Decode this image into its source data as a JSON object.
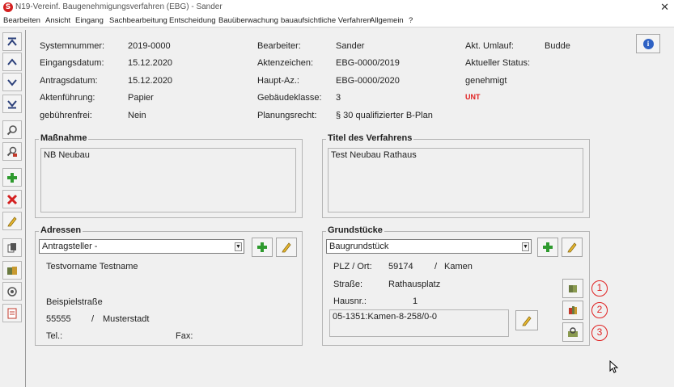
{
  "window": {
    "title": "N19-Vereinf. Baugenehmigungsverfahren (EBG) - Sander",
    "close_glyph": "✕",
    "app_icon_letter": "S"
  },
  "menu": [
    "Bearbeiten",
    "Ansicht",
    "Eingang",
    "Sachbearbeitung",
    "Entscheidung",
    "Bauüberwachung",
    "bauaufsichtliche Verfahren",
    "Allgemein",
    "?"
  ],
  "toolbar": {
    "first": "first-record-icon",
    "prev": "previous-record-icon",
    "next": "next-record-icon",
    "last": "last-record-icon",
    "search": "search-icon",
    "search_person": "search-person-icon",
    "add": "add-icon",
    "delete": "delete-icon",
    "edit": "pencil-icon",
    "copy": "copy-icon",
    "people": "people-icon",
    "eye": "eye-icon",
    "document": "document-icon"
  },
  "fields": {
    "systemnummer_label": "Systemnummer:",
    "systemnummer_value": "2019-0000",
    "eingangsdatum_label": "Eingangsdatum:",
    "eingangsdatum_value": "15.12.2020",
    "antragsdatum_label": "Antragsdatum:",
    "antragsdatum_value": "15.12.2020",
    "aktenfuehrung_label": "Aktenführung:",
    "aktenfuehrung_value": "Papier",
    "gebuehrenfrei_label": "gebührenfrei:",
    "gebuehrenfrei_value": "Nein",
    "bearbeiter_label": "Bearbeiter:",
    "bearbeiter_value": "Sander",
    "aktenzeichen_label": "Aktenzeichen:",
    "aktenzeichen_value": "EBG-0000/2019",
    "haupt_az_label": "Haupt-Az.:",
    "haupt_az_value": "EBG-0000/2020",
    "gebaeudeklasse_label": "Gebäudeklasse:",
    "gebaeudeklasse_value": "3",
    "planungsrecht_label": "Planungsrecht:",
    "planungsrecht_value": "§ 30 qualifizierter B-Plan",
    "umlauf_label": "Akt. Umlauf:",
    "umlauf_value": "Budde",
    "status_label": "Aktueller Status:",
    "status_value": "genehmigt",
    "unt_label": "UNT"
  },
  "colors": {
    "accent_red": "#e02020",
    "info_blue": "#2f62c4"
  },
  "massnahme": {
    "title": "Maßnahme",
    "text": "NB Neubau"
  },
  "titel": {
    "title": "Titel des Verfahrens",
    "text": "Test Neubau Rathaus"
  },
  "adressen": {
    "title": "Adressen",
    "combo_value": "Antragsteller  -",
    "name": "Testvorname Testname",
    "street": "Beispielstraße",
    "zip": "55555",
    "slash": "/",
    "city": "Musterstadt",
    "tel_label": "Tel.:",
    "fax_label": "Fax:"
  },
  "grundstuecke": {
    "title": "Grundstücke",
    "combo_value": "Baugrundstück",
    "plz_label": "PLZ / Ort:",
    "plz_value": "59174",
    "slash": "/",
    "ort_value": "Kamen",
    "strasse_label": "Straße:",
    "strasse_value": "Rathausplatz",
    "hausnr_label": "Hausnr.:",
    "hausnr_value": "1",
    "flurstueck": "05-1351:Kamen-8-258/0-0",
    "side_buttons": [
      "book-icon",
      "books-icon",
      "map-search-icon"
    ],
    "badges": [
      "1",
      "2",
      "3"
    ]
  }
}
